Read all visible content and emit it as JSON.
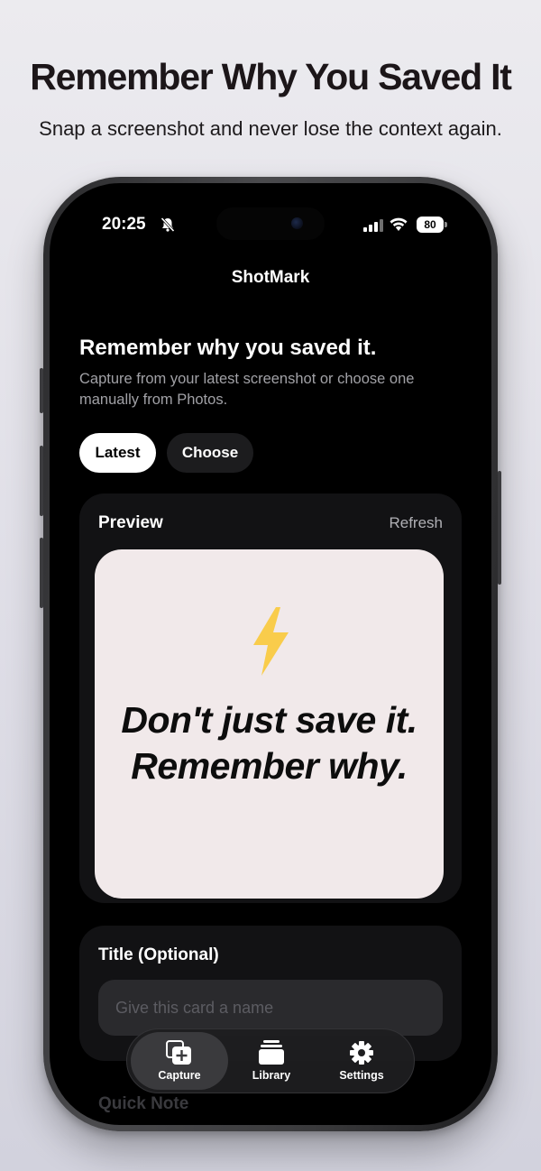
{
  "promo": {
    "title": "Remember Why You Saved It",
    "subtitle": "Snap a screenshot and never lose the context again."
  },
  "status_bar": {
    "time": "20:25",
    "battery": "80",
    "icons": [
      "bell-slash-icon",
      "signal-icon",
      "wifi-icon",
      "battery-icon"
    ]
  },
  "app": {
    "name": "ShotMark"
  },
  "capture": {
    "heading": "Remember why you saved it.",
    "description": "Capture from your latest screenshot or choose one manually from Photos.",
    "segments": [
      {
        "label": "Latest",
        "selected": true
      },
      {
        "label": "Choose",
        "selected": false
      }
    ]
  },
  "preview": {
    "title": "Preview",
    "action": "Refresh",
    "image_line1": "Don't just save it.",
    "image_line2": "Remember why.",
    "icon": "lightning-bolt-icon"
  },
  "title_field": {
    "label": "Title (Optional)",
    "placeholder": "Give this card a name"
  },
  "quick_note": {
    "label": "Quick Note"
  },
  "tabbar": {
    "tabs": [
      {
        "label": "Capture",
        "icon": "capture-plus-icon",
        "active": true
      },
      {
        "label": "Library",
        "icon": "library-stack-icon",
        "active": false
      },
      {
        "label": "Settings",
        "icon": "gear-icon",
        "active": false
      }
    ]
  },
  "colors": {
    "accent": "#ffffff",
    "screen_bg": "#000000",
    "card_bg": "#121214",
    "preview_bg": "#f1e9ea",
    "bolt": "#f9cc4b"
  }
}
